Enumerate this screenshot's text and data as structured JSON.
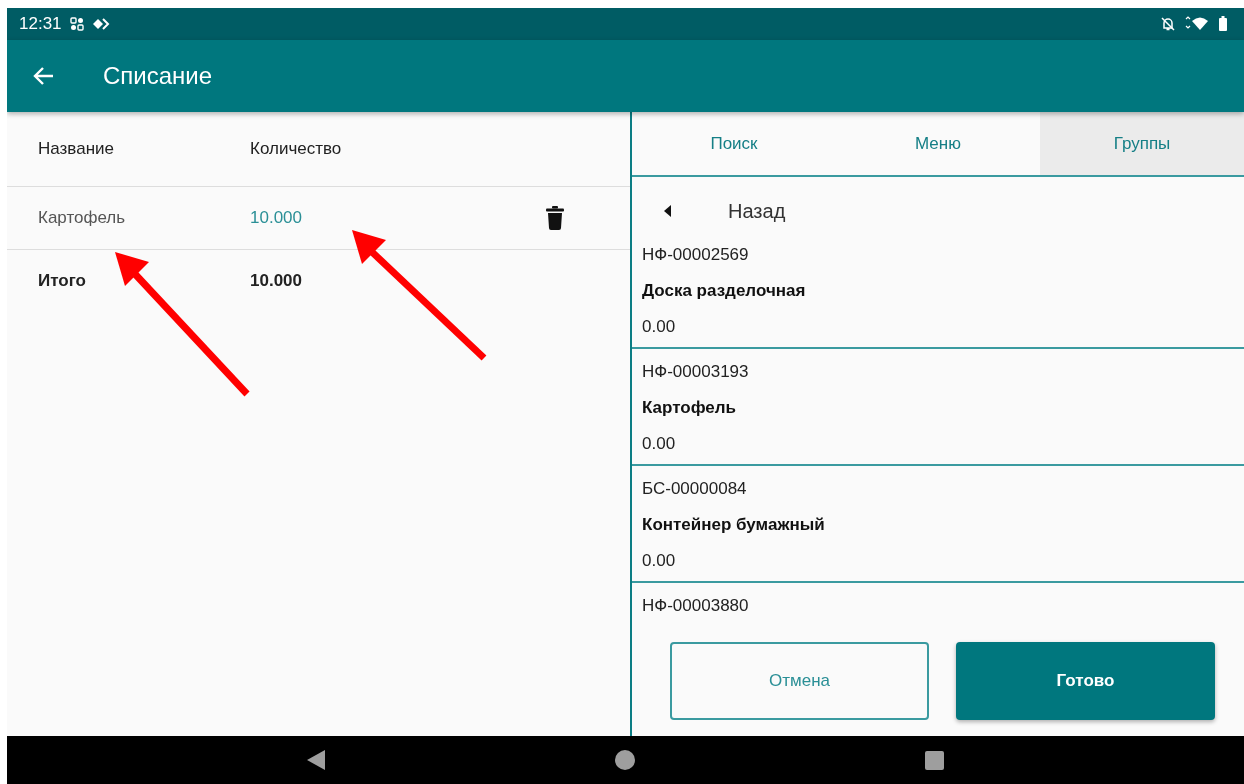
{
  "status_bar": {
    "time": "12:31"
  },
  "app_bar": {
    "title": "Списание"
  },
  "table": {
    "columns": [
      "Название",
      "Количество"
    ],
    "rows": [
      {
        "name": "Картофель",
        "quantity": "10.000"
      }
    ],
    "total": {
      "label": "Итого",
      "value": "10.000"
    }
  },
  "tabs": [
    {
      "label": "Поиск",
      "selected": false
    },
    {
      "label": "Меню",
      "selected": false
    },
    {
      "label": "Группы",
      "selected": true
    }
  ],
  "back": {
    "label": "Назад"
  },
  "items": [
    {
      "code": "НФ-00002569",
      "name": "Доска разделочная",
      "value": "0.00"
    },
    {
      "code": "НФ-00003193",
      "name": "Картофель",
      "value": "0.00"
    },
    {
      "code": "БС-00000084",
      "name": "Контейнер бумажный",
      "value": "0.00"
    },
    {
      "code": "НФ-00003880"
    }
  ],
  "buttons": [
    {
      "label": "Отмена",
      "kind": "outlined"
    },
    {
      "label": "Готово",
      "kind": "filled"
    }
  ]
}
